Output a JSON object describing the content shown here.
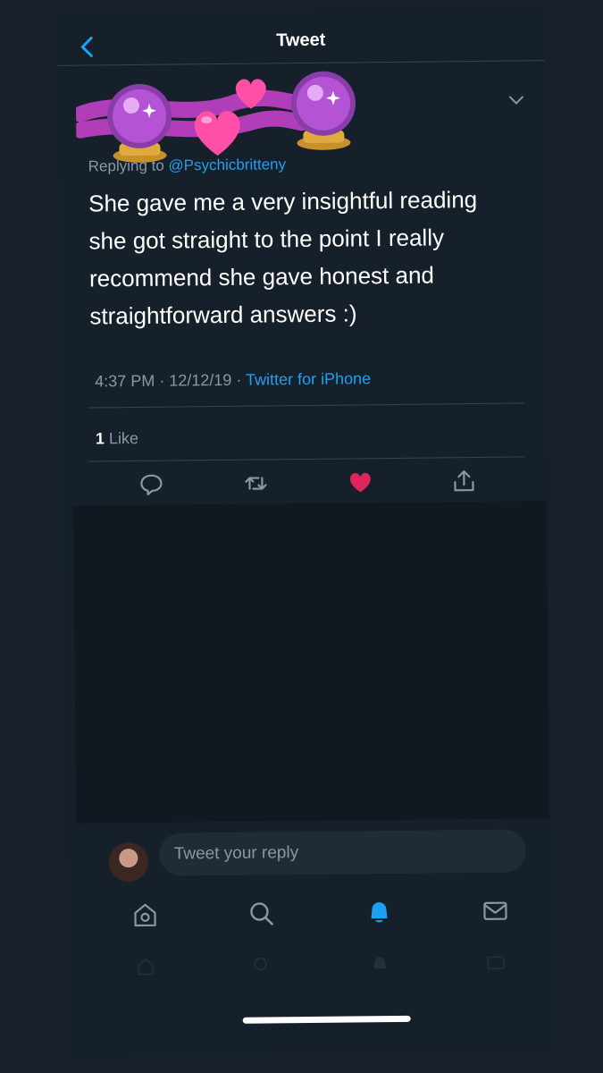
{
  "header": {
    "title": "Tweet",
    "back_icon": "chevron-left-icon"
  },
  "tweet": {
    "replying_prefix": "Replying to",
    "replying_handle": "@Psychicbritteny",
    "text": "She gave me a very insightful reading she got straight to the point I really recommend she gave honest and straightforward answers :)",
    "time": "4:37 PM",
    "date": "12/12/19",
    "separator": "·",
    "source": "Twitter for iPhone",
    "like_count": "1",
    "like_label": "Like"
  },
  "decorations": [
    "crystal-ball-emoji",
    "two-hearts-emoji",
    "crystal-ball-emoji"
  ],
  "actions": [
    "reply-icon",
    "retweet-icon",
    "like-icon",
    "share-icon"
  ],
  "reply": {
    "placeholder": "Tweet your reply"
  },
  "tabbar": [
    "home-icon",
    "search-icon",
    "notifications-icon",
    "messages-icon"
  ],
  "colors": {
    "background": "#16202b",
    "accent": "#1da1f2",
    "like": "#e0245e",
    "secondary_text": "#8899a6",
    "divider": "#38444d"
  }
}
